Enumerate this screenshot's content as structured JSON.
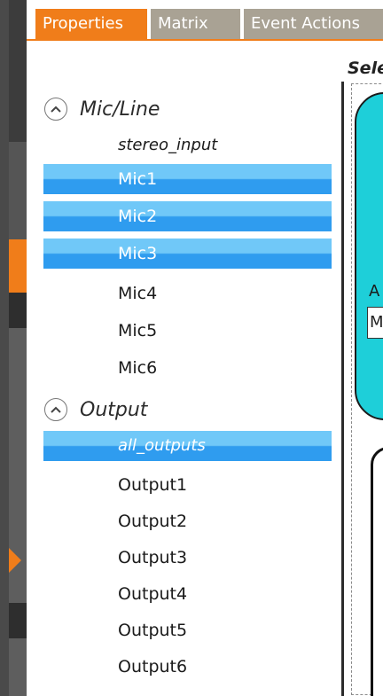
{
  "tabs": [
    {
      "label": "Properties",
      "active": true
    },
    {
      "label": "Matrix",
      "active": false
    },
    {
      "label": "Event Actions",
      "active": false
    }
  ],
  "tree": {
    "groups": [
      {
        "label": "Mic/Line",
        "items": [
          {
            "label": "stereo_input",
            "italic": true,
            "selected": false
          },
          {
            "label": "Mic1",
            "italic": false,
            "selected": true
          },
          {
            "label": "Mic2",
            "italic": false,
            "selected": true
          },
          {
            "label": "Mic3",
            "italic": false,
            "selected": true
          },
          {
            "label": "Mic4",
            "italic": false,
            "selected": false
          },
          {
            "label": "Mic5",
            "italic": false,
            "selected": false
          },
          {
            "label": "Mic6",
            "italic": false,
            "selected": false
          }
        ]
      },
      {
        "label": "Output",
        "items": [
          {
            "label": "all_outputs",
            "italic": true,
            "selected": true
          },
          {
            "label": "Output1",
            "italic": false,
            "selected": false
          },
          {
            "label": "Output2",
            "italic": false,
            "selected": false
          },
          {
            "label": "Output3",
            "italic": false,
            "selected": false
          },
          {
            "label": "Output4",
            "italic": false,
            "selected": false
          },
          {
            "label": "Output5",
            "italic": false,
            "selected": false
          },
          {
            "label": "Output6",
            "italic": false,
            "selected": false
          }
        ]
      }
    ]
  },
  "preview": {
    "header_partial": "Sele",
    "block_letter": "A",
    "box_letter": "M"
  },
  "colors": {
    "accent": "#f07d1a",
    "tab_inactive": "#a9a294",
    "selection_light": "#70c8f8",
    "selection_dark": "#2f9cef",
    "teal": "#1ecfd9"
  },
  "icons": {
    "group_toggle": "chevron-up-circle-icon",
    "strip_marker": "play-arrow-icon"
  }
}
